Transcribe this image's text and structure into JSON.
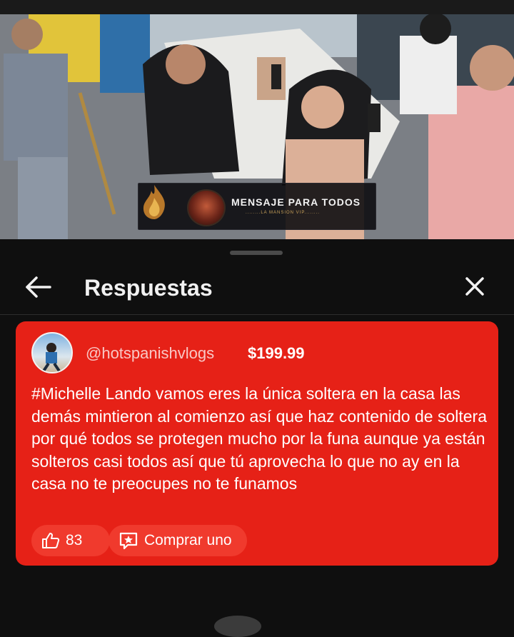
{
  "video": {
    "banner_title": "MENSAJE PARA TODOS",
    "banner_subtitle": "........LA MANSION VIP........"
  },
  "panel": {
    "title": "Respuestas",
    "back_icon": "arrow-left-icon",
    "close_icon": "close-icon"
  },
  "super_chat": {
    "card_color": "#e62117",
    "username": "@hotspanishvlogs",
    "amount": "$199.99",
    "message": "#Michelle Lando vamos eres la única soltera en la casa las demás mintieron al comienzo así que haz contenido de soltera por qué todos se protegen mucho por la funa aunque ya están solteros casi todos así que tú aprovecha lo que no ay en la casa no te preocupes no te funamos",
    "likes": "83",
    "like_icon": "thumbs-up-icon",
    "buy_label": "Comprar uno",
    "buy_icon": "super-chat-icon"
  }
}
